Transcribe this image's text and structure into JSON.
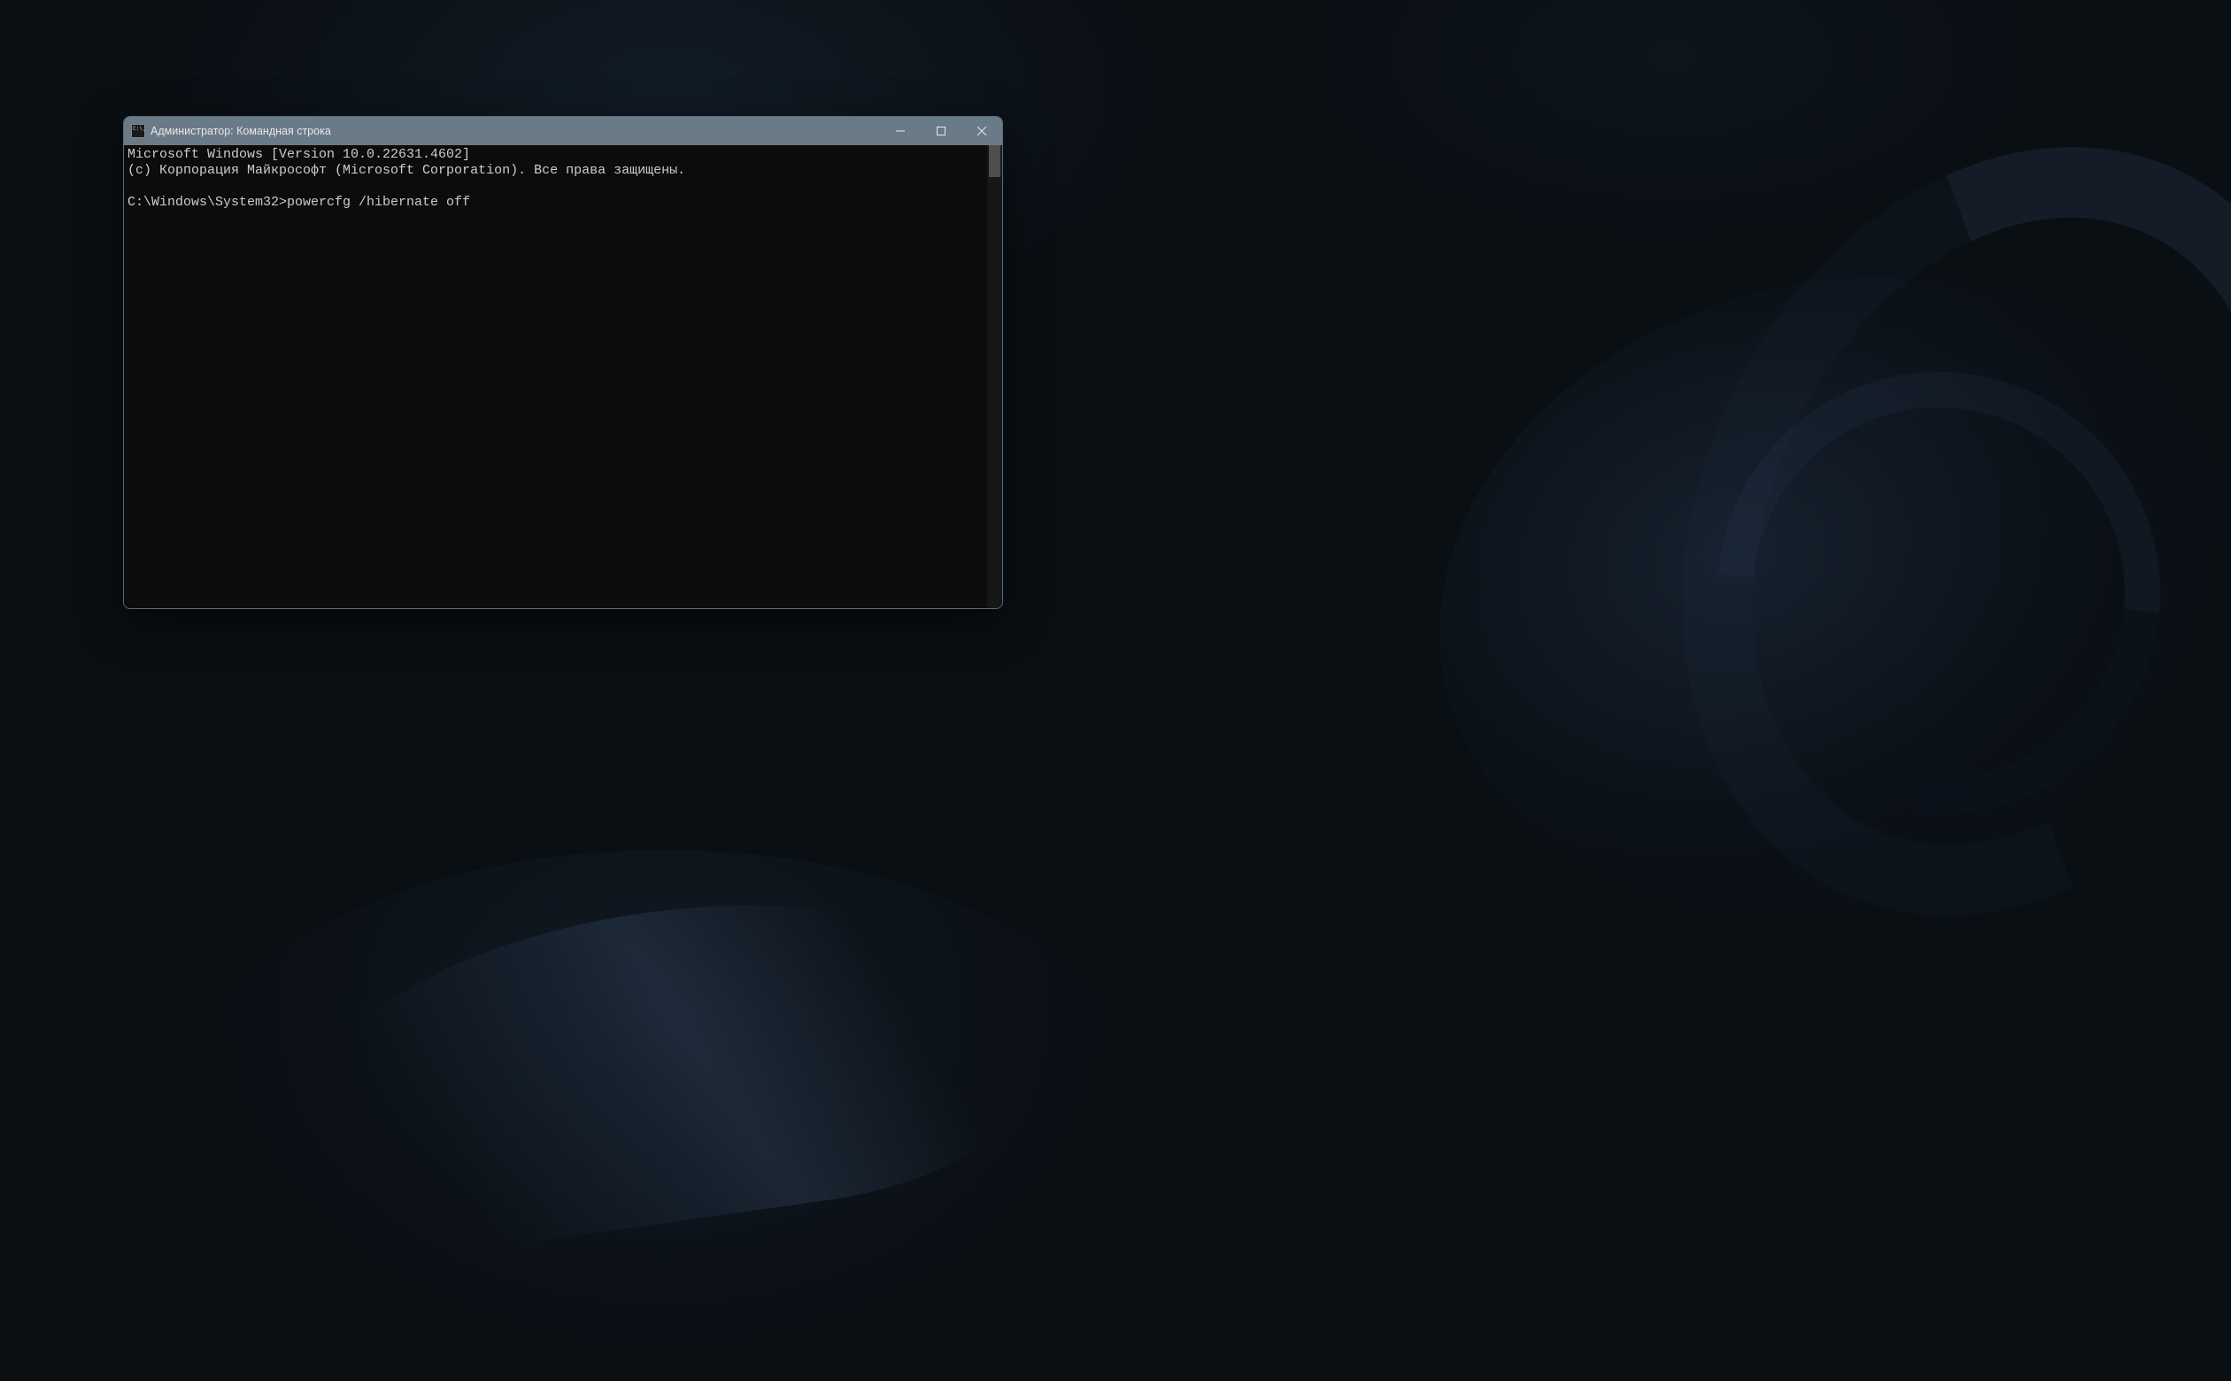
{
  "window": {
    "title": "Администратор: Командная строка"
  },
  "console": {
    "line1": "Microsoft Windows [Version 10.0.22631.4602]",
    "line2": "(c) Корпорация Майкрософт (Microsoft Corporation). Все права защищены.",
    "blank": "",
    "prompt": "C:\\Windows\\System32>",
    "command": "powercfg /hibernate off"
  }
}
